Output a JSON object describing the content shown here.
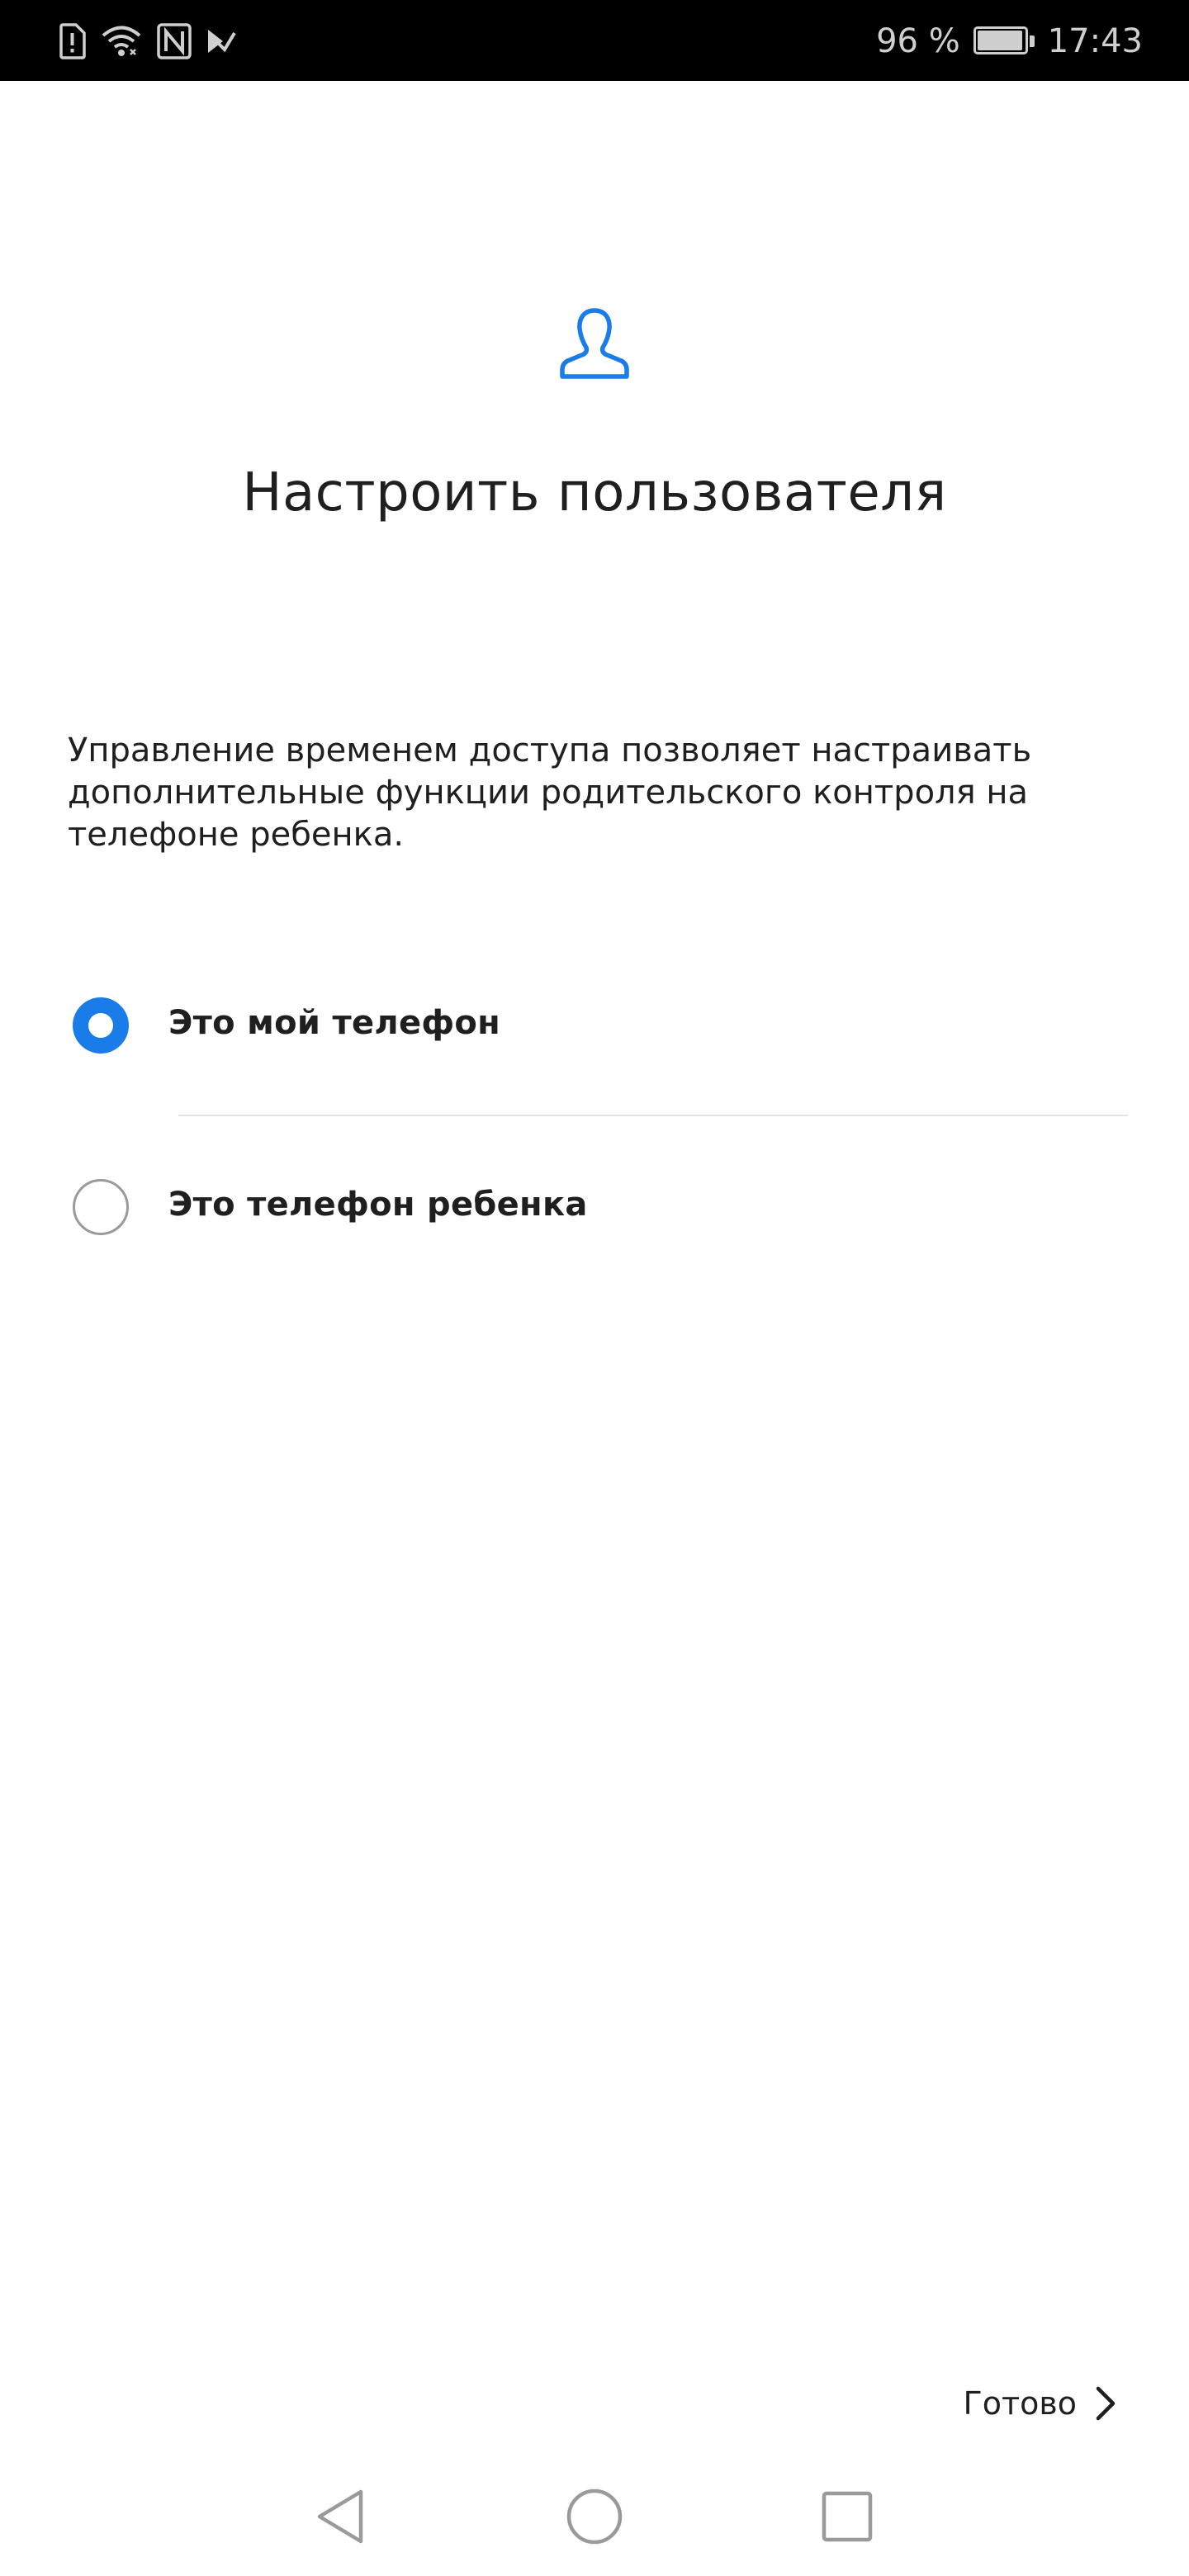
{
  "status_bar": {
    "battery_text": "96 %",
    "battery_level": 0.96,
    "time": "17:43",
    "icons": [
      "sim-alert-icon",
      "wifi-icon",
      "nfc-icon",
      "signal-check-icon"
    ]
  },
  "header": {
    "icon": "user-icon",
    "title": "Настроить пользователя"
  },
  "description": "Управление временем доступа позволяет настраивать дополнительные функции родительского контроля на телефоне ребенка.",
  "options": [
    {
      "label": "Это мой телефон",
      "selected": true
    },
    {
      "label": "Это телефон ребенка",
      "selected": false
    }
  ],
  "footer": {
    "done_label": "Готово",
    "done_icon": "chevron-right-icon"
  },
  "nav": {
    "icons": [
      "back-icon",
      "home-icon",
      "recent-apps-icon"
    ]
  },
  "colors": {
    "accent": "#1a7ce8",
    "status_bar_bg": "#000000",
    "text": "#1f1f1f"
  }
}
